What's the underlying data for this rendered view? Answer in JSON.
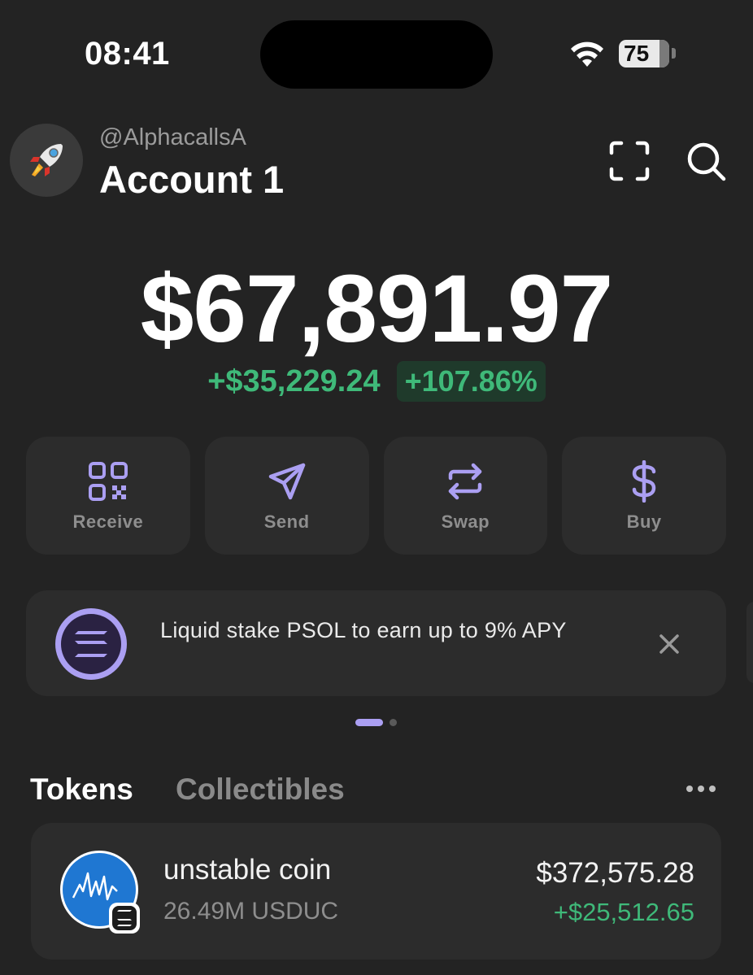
{
  "status_bar": {
    "time": "08:41",
    "battery": "75",
    "icons": [
      "wifi-icon",
      "battery-icon"
    ]
  },
  "header": {
    "handle": "@AlphacallsA",
    "account_name": "Account 1",
    "avatar_icon": "rocket-icon",
    "actions": [
      "scan-icon",
      "search-icon"
    ]
  },
  "balance": {
    "total": "$67,891.97",
    "change_amount": "+$35,229.24",
    "change_percent": "+107.86%"
  },
  "actions": [
    {
      "label": "Receive",
      "icon": "qr-code-icon"
    },
    {
      "label": "Send",
      "icon": "send-icon"
    },
    {
      "label": "Swap",
      "icon": "swap-icon"
    },
    {
      "label": "Buy",
      "icon": "dollar-icon"
    }
  ],
  "banner": {
    "text": "Liquid stake PSOL to earn up to 9% APY",
    "icon": "solana-icon",
    "page_indicator": {
      "current": 1,
      "total": 2
    }
  },
  "tabs": [
    {
      "label": "Tokens",
      "active": true
    },
    {
      "label": "Collectibles",
      "active": false
    }
  ],
  "tokens": [
    {
      "name": "unstable coin",
      "amount": "26.49M USDUC",
      "value": "$372,575.28",
      "change": "+$25,512.65"
    }
  ],
  "colors": {
    "background": "#232323",
    "card": "#2c2c2c",
    "accent": "#ab9ff2",
    "positive": "#3fb979"
  }
}
